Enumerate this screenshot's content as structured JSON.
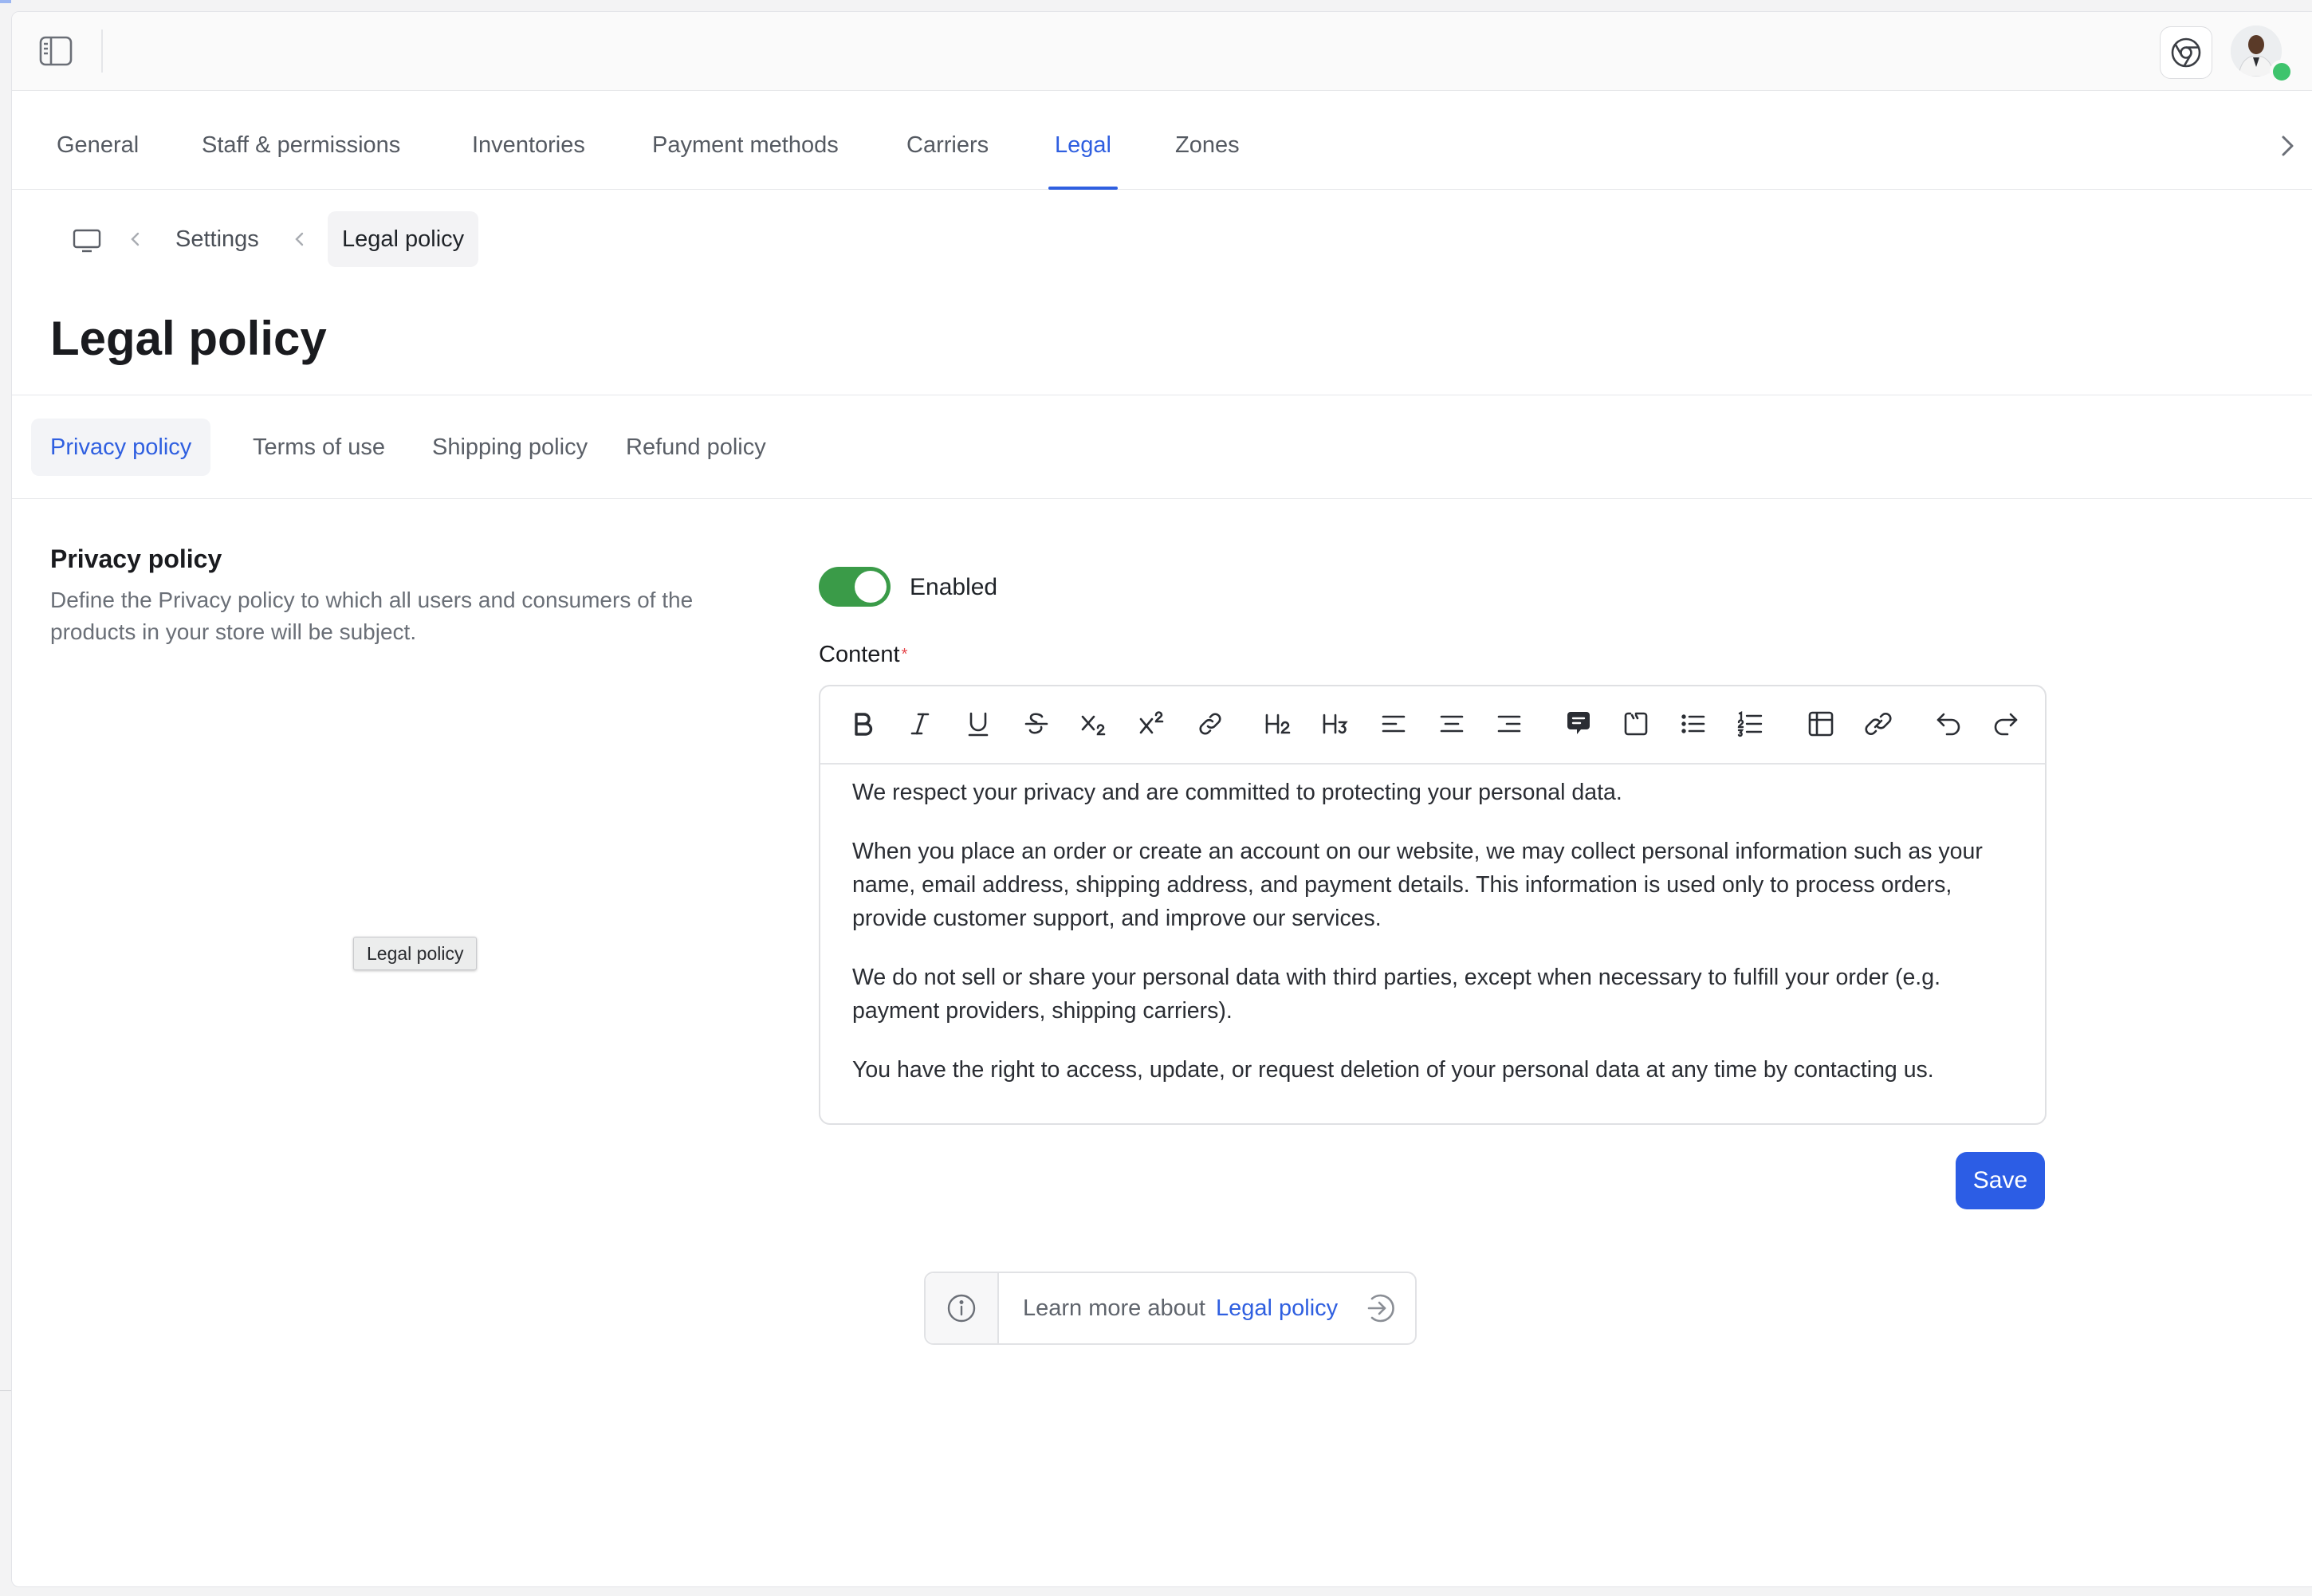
{
  "nav_tabs": {
    "general": "General",
    "staff": "Staff & permissions",
    "inventories": "Inventories",
    "payment": "Payment methods",
    "carriers": "Carriers",
    "legal": "Legal",
    "zones": "Zones",
    "active": "Legal"
  },
  "breadcrumb": {
    "settings": "Settings",
    "current": "Legal policy"
  },
  "page": {
    "title": "Legal policy"
  },
  "sub_tabs": {
    "privacy": "Privacy policy",
    "terms": "Terms of use",
    "shipping": "Shipping policy",
    "refund": "Refund policy",
    "active": "Privacy policy"
  },
  "section": {
    "title": "Privacy policy",
    "description": "Define the Privacy policy to which all users and consumers of the products in your store will be subject."
  },
  "drag_tooltip": "Legal policy",
  "toggle": {
    "label": "Enabled",
    "on": true,
    "color": "#3a9b48"
  },
  "content_field": {
    "label": "Content",
    "required_mark": "*"
  },
  "editor": {
    "toolbar_icons": [
      "bold-icon",
      "italic-icon",
      "underline-icon",
      "strikethrough-icon",
      "subscript-icon",
      "superscript-icon",
      "link-icon",
      "heading-2-icon",
      "heading-3-icon",
      "align-left-icon",
      "align-center-icon",
      "align-right-icon",
      "comment-icon",
      "code-block-icon",
      "bullet-list-icon",
      "ordered-list-icon",
      "table-icon",
      "unlink-icon",
      "undo-icon",
      "redo-icon"
    ],
    "paragraphs": [
      "We respect your privacy and are committed to protecting your personal data.",
      "When you place an order or create an account on our website, we may collect personal information such as your name, email address, shipping address, and payment details. This information is used only to process orders, provide customer support, and improve our services.",
      "We do not sell or share your personal data with third parties, except when necessary to fulfill your order (e.g. payment providers, shipping carriers).",
      "You have the right to access, update, or request deletion of your personal data at any time by contacting us."
    ]
  },
  "save_label": "Save",
  "learn_more": {
    "text": "Learn more about",
    "link": "Legal policy"
  },
  "colors": {
    "accent": "#2f5fe0",
    "save_button": "#2c5de5"
  }
}
